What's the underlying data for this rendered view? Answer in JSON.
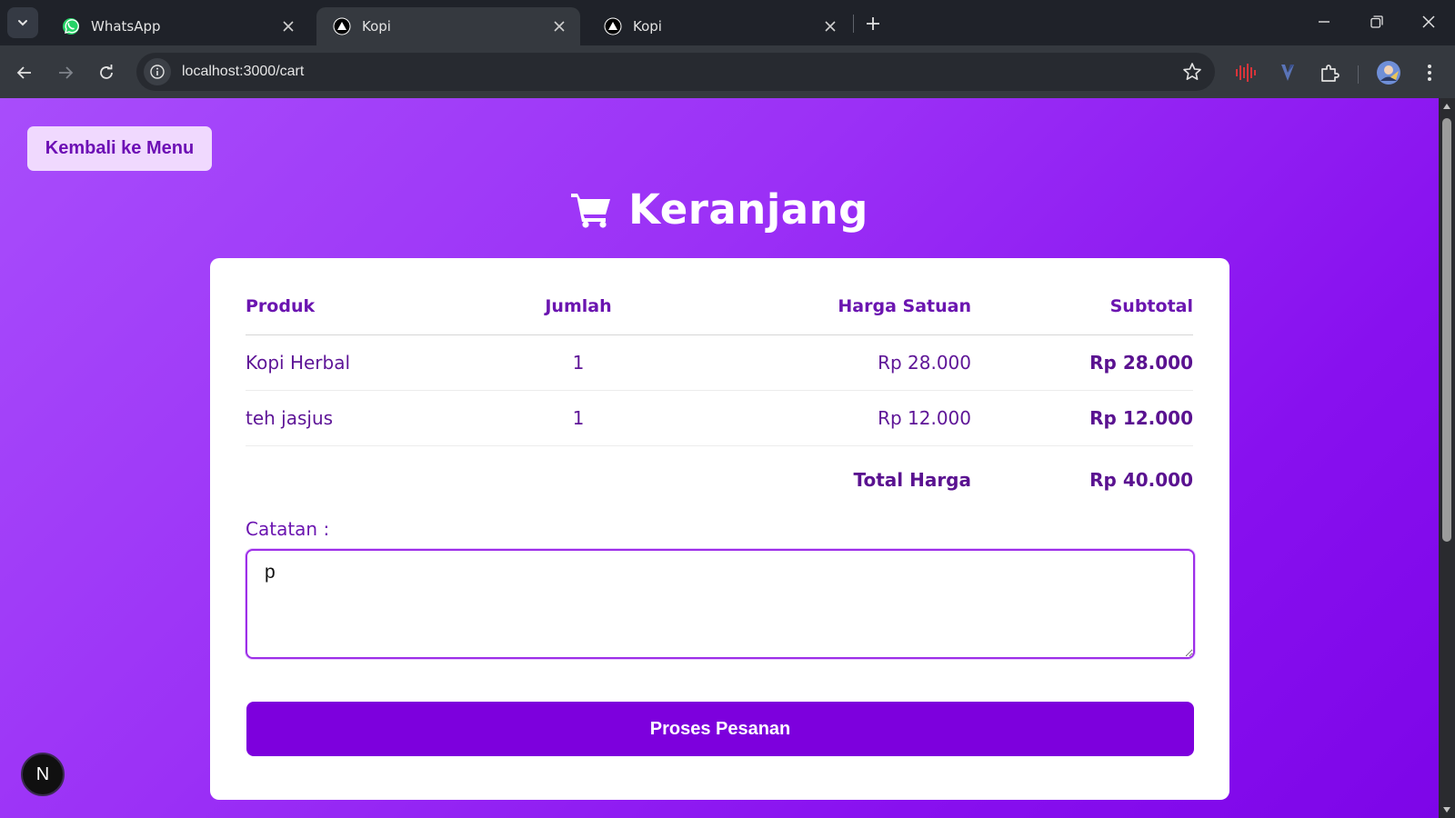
{
  "browser": {
    "tabs": [
      {
        "title": "WhatsApp",
        "icon": "whatsapp-icon",
        "active": false
      },
      {
        "title": "Kopi",
        "icon": "vercel-triangle-icon",
        "active": true
      },
      {
        "title": "Kopi",
        "icon": "vercel-triangle-icon",
        "active": false
      }
    ],
    "address_bar": {
      "url": "localhost:3000/cart"
    }
  },
  "page": {
    "back_button_label": "Kembali ke Menu",
    "title": "Keranjang",
    "title_icon": "shopping-cart-icon",
    "table": {
      "headers": [
        "Produk",
        "Jumlah",
        "Harga Satuan",
        "Subtotal"
      ],
      "rows": [
        {
          "product": "Kopi Herbal",
          "qty": "1",
          "unit_price": "Rp 28.000",
          "subtotal": "Rp 28.000"
        },
        {
          "product": "teh jasjus",
          "qty": "1",
          "unit_price": "Rp 12.000",
          "subtotal": "Rp 12.000"
        }
      ],
      "total_label": "Total Harga",
      "total_value": "Rp 40.000"
    },
    "note": {
      "label": "Catatan :",
      "value": "p"
    },
    "submit_label": "Proses Pesanan",
    "dev_badge": "N"
  },
  "colors": {
    "accent": "#7d00dd",
    "background_gradient_start": "#a84dfb",
    "background_gradient_end": "#7d05e8",
    "text_purple": "#5e1597",
    "back_button_bg": "#f0d9fe"
  }
}
